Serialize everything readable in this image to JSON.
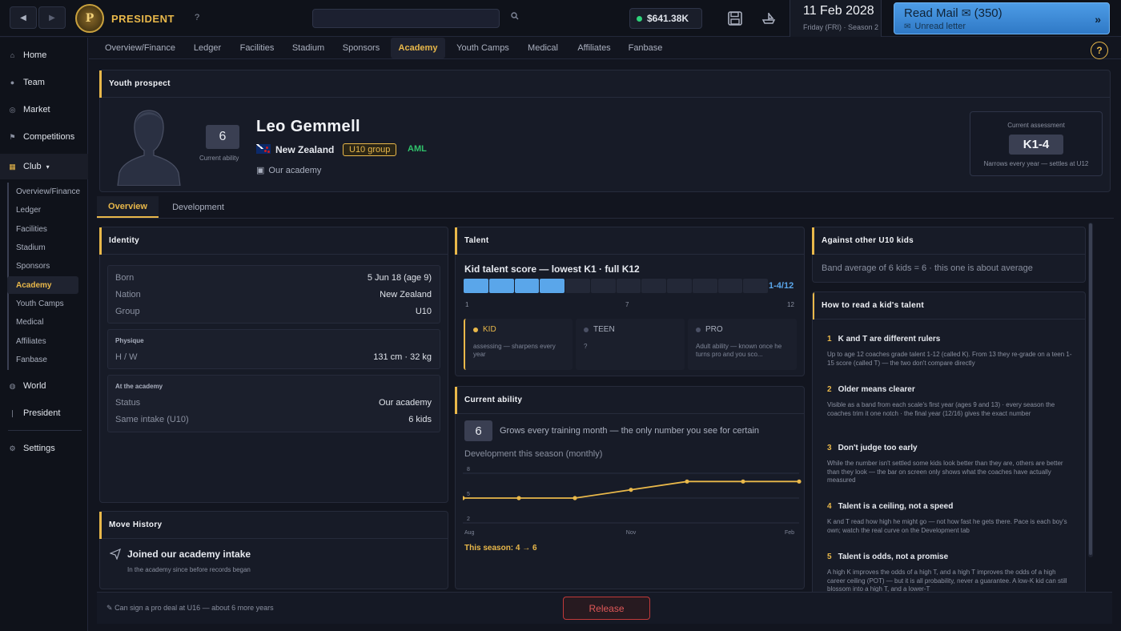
{
  "topbar": {
    "brand": "PRESIDENT",
    "logo_letter": "P",
    "help_label": "?",
    "back_icon": "◀",
    "forward_icon": "▶",
    "search_icon": "🔍",
    "money": "$641.38K",
    "date": "11 Feb 2028",
    "date_sub": "Friday (FRI) · Season 2",
    "mail_title": "Read Mail",
    "mail_count": "(350)",
    "mail_sub": "Unread letter",
    "mail_arrow": "»"
  },
  "sidebar": {
    "items": [
      {
        "label": "Home",
        "icon": "home-icon"
      },
      {
        "label": "Team",
        "icon": "team-icon"
      },
      {
        "label": "Market",
        "icon": "market-icon"
      },
      {
        "label": "Competitions",
        "icon": "competitions-icon"
      },
      {
        "label": "Club",
        "icon": "club-icon"
      },
      {
        "label": "World",
        "icon": "world-icon"
      },
      {
        "label": "President",
        "icon": "president-icon"
      },
      {
        "label": "Settings",
        "icon": "settings-icon"
      }
    ],
    "club_caret": "▾",
    "club_sub": [
      "Overview/Finance",
      "Ledger",
      "Facilities",
      "Stadium",
      "Sponsors",
      "Academy",
      "Youth Camps",
      "Medical",
      "Affiliates",
      "Fanbase"
    ],
    "active_sub": "Academy"
  },
  "tabs": [
    "Overview/Finance",
    "Ledger",
    "Facilities",
    "Stadium",
    "Sponsors",
    "Academy",
    "Youth Camps",
    "Medical",
    "Affiliates",
    "Fanbase"
  ],
  "active_tab": "Academy",
  "help_q": "?",
  "prospect": {
    "header": "Youth prospect",
    "ability": "6",
    "ability_label": "Current ability",
    "name": "Leo Gemmell",
    "nation": "New Zealand",
    "group": "U10 group",
    "tag": "AML",
    "academy": "Our academy",
    "assessment_label": "Current assessment",
    "assessment": "K1-4",
    "assessment_note": "Narrows every year — settles at U12"
  },
  "subtabs": [
    "Overview",
    "Development"
  ],
  "active_subtab": "Overview",
  "identity": {
    "header": "Identity",
    "rows": [
      {
        "k": "Born",
        "v": "5 Jun 18 (age 9)"
      },
      {
        "k": "Nation",
        "v": "New Zealand"
      },
      {
        "k": "Group",
        "v": "U10"
      }
    ],
    "physique_label": "Physique",
    "physique": {
      "k": "H / W",
      "v": "131 cm · 32 kg"
    },
    "academy_label": "At the academy",
    "academy_rows": [
      {
        "k": "Status",
        "v": "Our academy"
      },
      {
        "k": "Same intake (U10)",
        "v": "6 kids"
      }
    ]
  },
  "move_history": {
    "header": "Move History",
    "title": "Joined our academy intake",
    "sub": "In the academy since before records began"
  },
  "talent": {
    "header": "Talent",
    "line": "Kid talent score — lowest K1 · full K12",
    "total": 12,
    "filled": 4,
    "range": "1-4/12",
    "ticks": [
      "1",
      "7",
      "12"
    ],
    "stages": [
      {
        "name": "KID",
        "body": "assessing — sharpens every year"
      },
      {
        "name": "TEEN",
        "body": "?"
      },
      {
        "name": "PRO",
        "body": "Adult ability — known once he turns pro and you sco..."
      }
    ]
  },
  "current_ability": {
    "header": "Current ability",
    "value": "6",
    "desc": "Grows every training month — the only number you see for certain",
    "dev_label": "Development this season (monthly)",
    "season_text": "This season: 4 → 6"
  },
  "chart_data": {
    "type": "line",
    "title": "Development this season (monthly)",
    "x": [
      "Aug",
      "Sep",
      "Oct",
      "Nov",
      "Dec",
      "Jan",
      "Feb"
    ],
    "x_tick_labels": [
      "Aug",
      "Nov",
      "Feb"
    ],
    "series": [
      {
        "values": [
          5,
          5,
          5,
          6,
          7,
          7,
          7
        ]
      }
    ],
    "ylim": [
      2,
      8
    ],
    "y_ticks": [
      2,
      5,
      8
    ],
    "color": "#e9b84a",
    "grid": true
  },
  "against": {
    "header": "Against other U10 kids",
    "text": "Band average of 6 kids = 6 · this one is about average"
  },
  "howto": {
    "header": "How to read a kid's talent",
    "items": [
      {
        "n": "1",
        "h": "K and T are different rulers",
        "b": "Up to age 12 coaches grade talent 1-12 (called K). From 13 they re-grade on a teen 1-15 score (called T) — the two don't compare directly"
      },
      {
        "n": "2",
        "h": "Older means clearer",
        "b": "Visible as a band from each scale's first year (ages 9 and 13) · every season the coaches trim it one notch · the final year (12/16) gives the exact number"
      },
      {
        "n": "3",
        "h": "Don't judge too early",
        "b": "While the number isn't settled some kids look better than they are, others are better than they look — the bar on screen only shows what the coaches have actually measured"
      },
      {
        "n": "4",
        "h": "Talent is a ceiling, not a speed",
        "b": "K and T read how high he might go — not how fast he gets there. Pace is each boy's own; watch the real curve on the Development tab"
      },
      {
        "n": "5",
        "h": "Talent is odds, not a promise",
        "b": "A high K improves the odds of a high T, and a high T improves the odds of a high career ceiling (POT) — but it is all probability, never a guarantee. A low-K kid can still blossom into a high T, and a lower-T"
      }
    ]
  },
  "footer": {
    "note": "Can sign a pro deal at U16 — about 6 more years",
    "release": "Release"
  }
}
